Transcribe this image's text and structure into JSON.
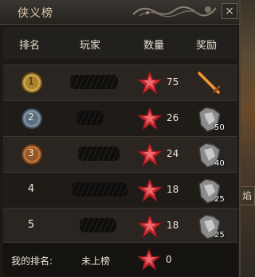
{
  "window": {
    "title": "侠义榜",
    "close_label": "×"
  },
  "side_label": "焰",
  "columns": [
    "排名",
    "玩家",
    "数量",
    "奖励"
  ],
  "rows": [
    {
      "rank": "1",
      "medal": "gold-medal-icon",
      "qty": "75",
      "reward_icon": "sword-icon",
      "reward_count": ""
    },
    {
      "rank": "2",
      "medal": "silver-medal-icon",
      "qty": "26",
      "reward_icon": "armor-icon",
      "reward_count": "50"
    },
    {
      "rank": "3",
      "medal": "bronze-medal-icon",
      "qty": "24",
      "reward_icon": "armor-icon",
      "reward_count": "40"
    },
    {
      "rank": "4",
      "medal": "",
      "qty": "18",
      "reward_icon": "armor-icon",
      "reward_count": "25"
    },
    {
      "rank": "5",
      "medal": "",
      "qty": "18",
      "reward_icon": "armor-icon",
      "reward_count": "25"
    }
  ],
  "footer": {
    "label": "我的排名:",
    "value": "未上榜",
    "qty": "0"
  },
  "colors": {
    "star": "#d8323a",
    "gold": "#c9a44a",
    "silver": "#7d8fa0",
    "bronze": "#b8743c"
  }
}
